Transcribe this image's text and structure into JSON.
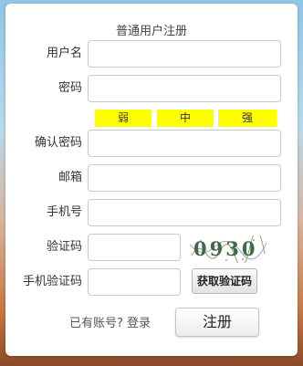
{
  "form": {
    "title": "普通用户注册",
    "fields": {
      "username": {
        "label": "用户名",
        "value": ""
      },
      "password": {
        "label": "密码",
        "value": ""
      },
      "confirm_password": {
        "label": "确认密码",
        "value": ""
      },
      "email": {
        "label": "邮箱",
        "value": ""
      },
      "phone": {
        "label": "手机号",
        "value": ""
      },
      "captcha": {
        "label": "验证码",
        "value": ""
      },
      "sms_code": {
        "label": "手机验证码",
        "value": ""
      }
    },
    "strength": {
      "weak": "弱",
      "medium": "中",
      "strong": "强",
      "color": "#ffff00"
    },
    "captcha_image_text": "0930",
    "get_code_button": "获取验证码",
    "login_prompt": "已有账号?",
    "login_link": "登录",
    "register_button": "注册"
  }
}
